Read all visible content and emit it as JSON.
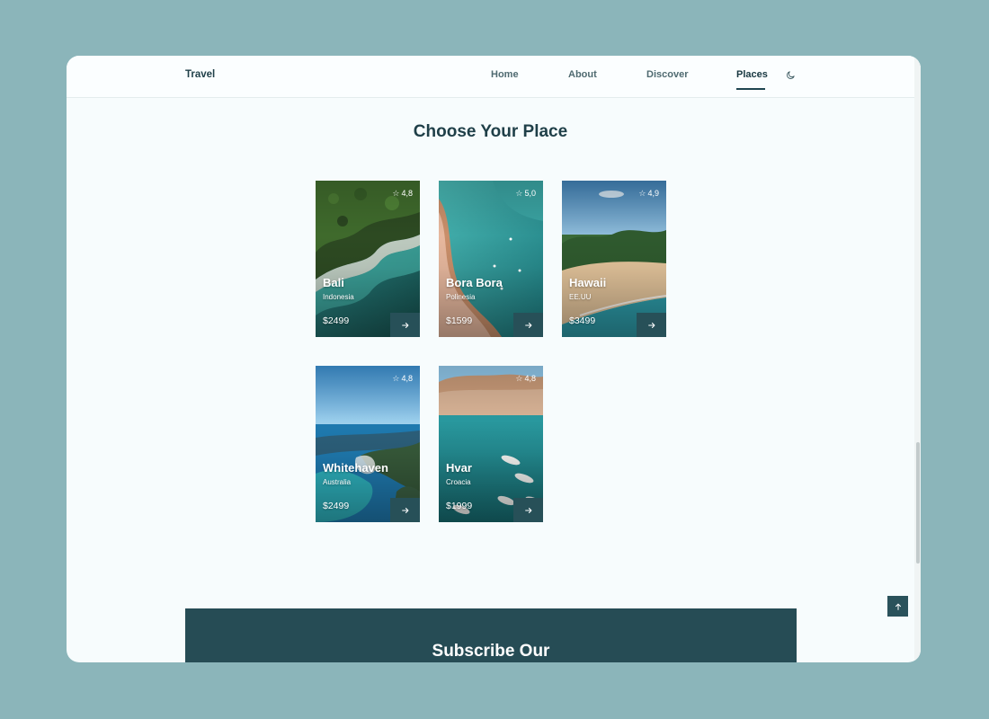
{
  "header": {
    "logo": "Travel",
    "nav": [
      {
        "label": "Home"
      },
      {
        "label": "About"
      },
      {
        "label": "Discover"
      },
      {
        "label": "Places",
        "active": true
      }
    ],
    "theme_icon": "moon-icon"
  },
  "main": {
    "title": "Choose Your Place",
    "places": [
      {
        "name": "Bali",
        "country": "Indonesia",
        "price": "$2499",
        "rating": "4,8"
      },
      {
        "name": "Bora Bora",
        "country": "Polinesia",
        "price": "$1599",
        "rating": "5,0"
      },
      {
        "name": "Hawaii",
        "country": "EE.UU",
        "price": "$3499",
        "rating": "4,9"
      },
      {
        "name": "Whitehaven",
        "country": "Australia",
        "price": "$2499",
        "rating": "4,8"
      },
      {
        "name": "Hvar",
        "country": "Croacia",
        "price": "$1999",
        "rating": "4,8"
      }
    ],
    "card_icons": {
      "rating": "star-icon",
      "go": "arrow-right-icon"
    }
  },
  "subscribe": {
    "title": "Subscribe Our"
  },
  "scroll_top_icon": "arrow-up-icon",
  "colors": {
    "background": "#8bb5ba",
    "page": "#f7fcfd",
    "accent": "#275058",
    "heading": "#1f3f48"
  }
}
